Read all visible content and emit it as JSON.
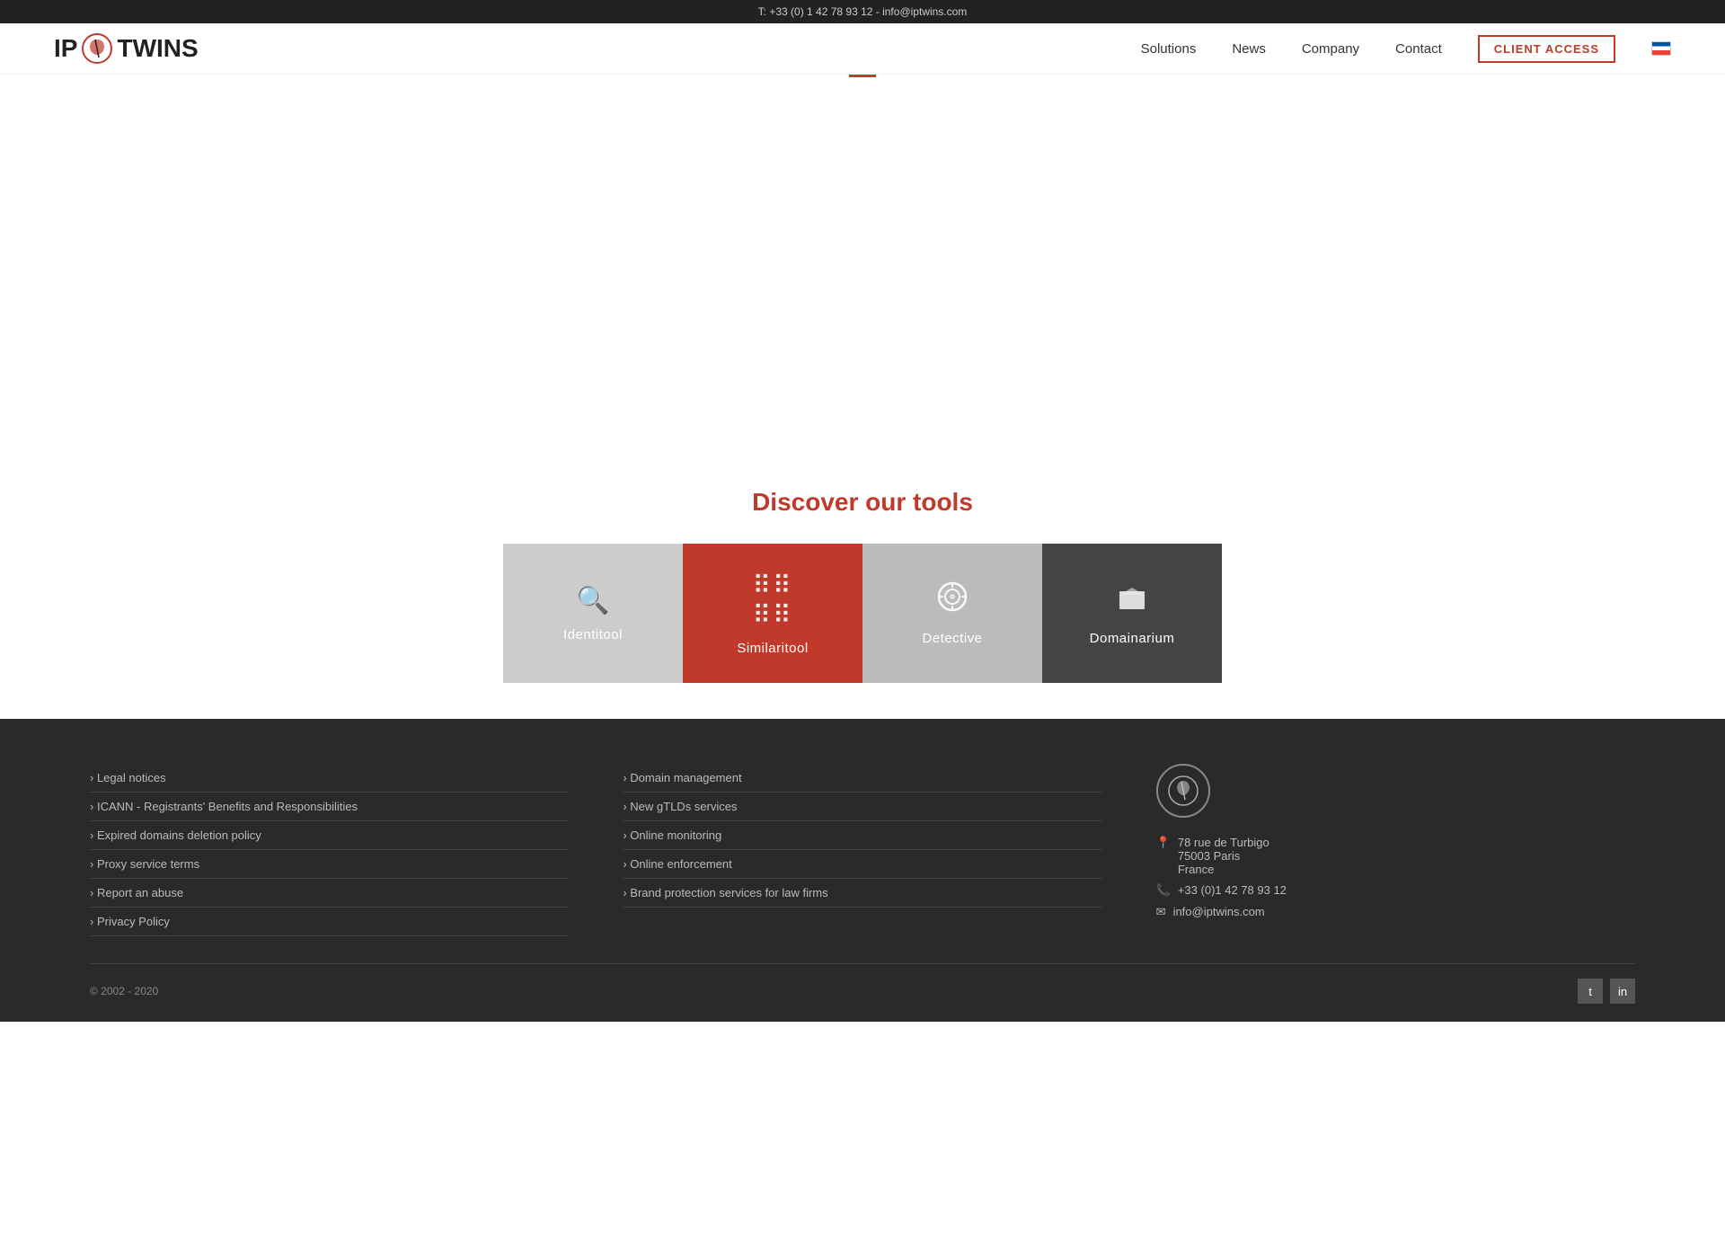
{
  "topbar": {
    "text": "T: +33 (0) 1 42 78 93 12 - info@iptwins.com"
  },
  "header": {
    "logo_text_left": "IP",
    "logo_text_right": "TWINS",
    "nav": {
      "solutions": "Solutions",
      "news": "News",
      "company": "Company",
      "contact": "Contact",
      "client_access": "CLIENT ACCESS"
    }
  },
  "discover": {
    "title": "Discover our tools",
    "tools": [
      {
        "id": "identitool",
        "label": "Identitool",
        "icon": "🔍",
        "theme": "grey"
      },
      {
        "id": "similaritool",
        "label": "Similaritool",
        "icon": "⠿",
        "theme": "red"
      },
      {
        "id": "detective",
        "label": "Detective",
        "icon": "◎",
        "theme": "light-grey"
      },
      {
        "id": "domainarium",
        "label": "Domainarium",
        "icon": "📁",
        "theme": "dark"
      }
    ]
  },
  "footer": {
    "col1": {
      "links": [
        "Legal notices",
        "ICANN - Registrants' Benefits and Responsibilities",
        "Expired domains deletion policy",
        "Proxy service terms",
        "Report an abuse",
        "Privacy Policy"
      ]
    },
    "col2": {
      "links": [
        "Domain management",
        "New gTLDs services",
        "Online monitoring",
        "Online enforcement",
        "Brand protection services for law firms"
      ]
    },
    "contact": {
      "address_line1": "78 rue de Turbigo",
      "address_line2": "75003 Paris",
      "address_line3": "France",
      "phone": "+33 (0)1 42 78 93 12",
      "email": "info@iptwins.com"
    },
    "copyright": "© 2002 - 2020"
  }
}
